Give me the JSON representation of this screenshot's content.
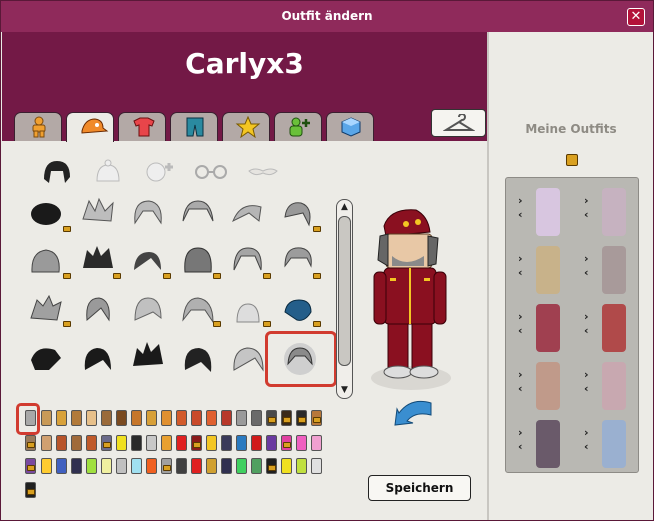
{
  "window": {
    "title": "Outfit ändern",
    "close_label": "✕"
  },
  "user": {
    "name": "Carlyx3"
  },
  "tabs": [
    {
      "name": "tab-body",
      "icon": "body-icon",
      "active": false
    },
    {
      "name": "tab-hats",
      "icon": "cap-icon",
      "active": true
    },
    {
      "name": "tab-tops",
      "icon": "shirt-icon",
      "active": false
    },
    {
      "name": "tab-bottoms",
      "icon": "pants-icon",
      "active": false
    },
    {
      "name": "tab-effects",
      "icon": "star-icon",
      "active": false
    },
    {
      "name": "tab-pets",
      "icon": "person-plus-icon",
      "active": false
    },
    {
      "name": "tab-extras",
      "icon": "cube-icon",
      "active": false
    }
  ],
  "outfits": {
    "title": "Meine Outfits",
    "slots_left_filled": [
      true,
      true,
      true,
      true,
      true
    ],
    "slots_right_filled": [
      true,
      true,
      true,
      true,
      true
    ]
  },
  "colors": {
    "accent": "#8f2a5b",
    "header": "#731946",
    "selection": "#d13b2f",
    "hc_badge": "#d9a020"
  },
  "footer": {
    "save_label": "Speichern"
  }
}
